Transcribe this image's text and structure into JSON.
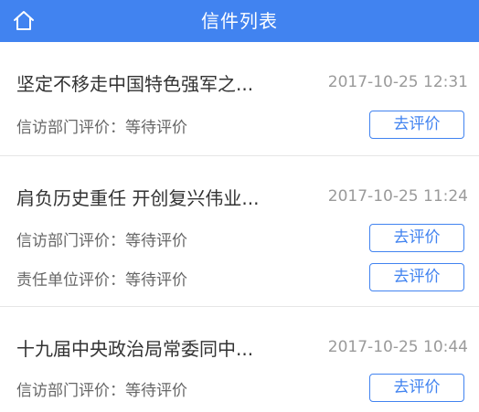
{
  "header": {
    "title": "信件列表",
    "home_icon": "home-icon",
    "background_color": "#4183f0"
  },
  "letters": [
    {
      "title": "坚定不移走中国特色强军之...",
      "time": "2017-10-25 12:31",
      "evaluations": [
        {
          "label": "信访部门评价：等待评价",
          "button": "去评价"
        }
      ]
    },
    {
      "title": "肩负历史重任 开创复兴伟业...",
      "time": "2017-10-25 11:24",
      "evaluations": [
        {
          "label": "信访部门评价：等待评价",
          "button": "去评价"
        },
        {
          "label": "责任单位评价：等待评价",
          "button": "去评价"
        }
      ]
    },
    {
      "title": "十九届中央政治局常委同中...",
      "time": "2017-10-25 10:44",
      "evaluations": [
        {
          "label": "信访部门评价：等待评价",
          "button": "去评价"
        }
      ]
    }
  ]
}
